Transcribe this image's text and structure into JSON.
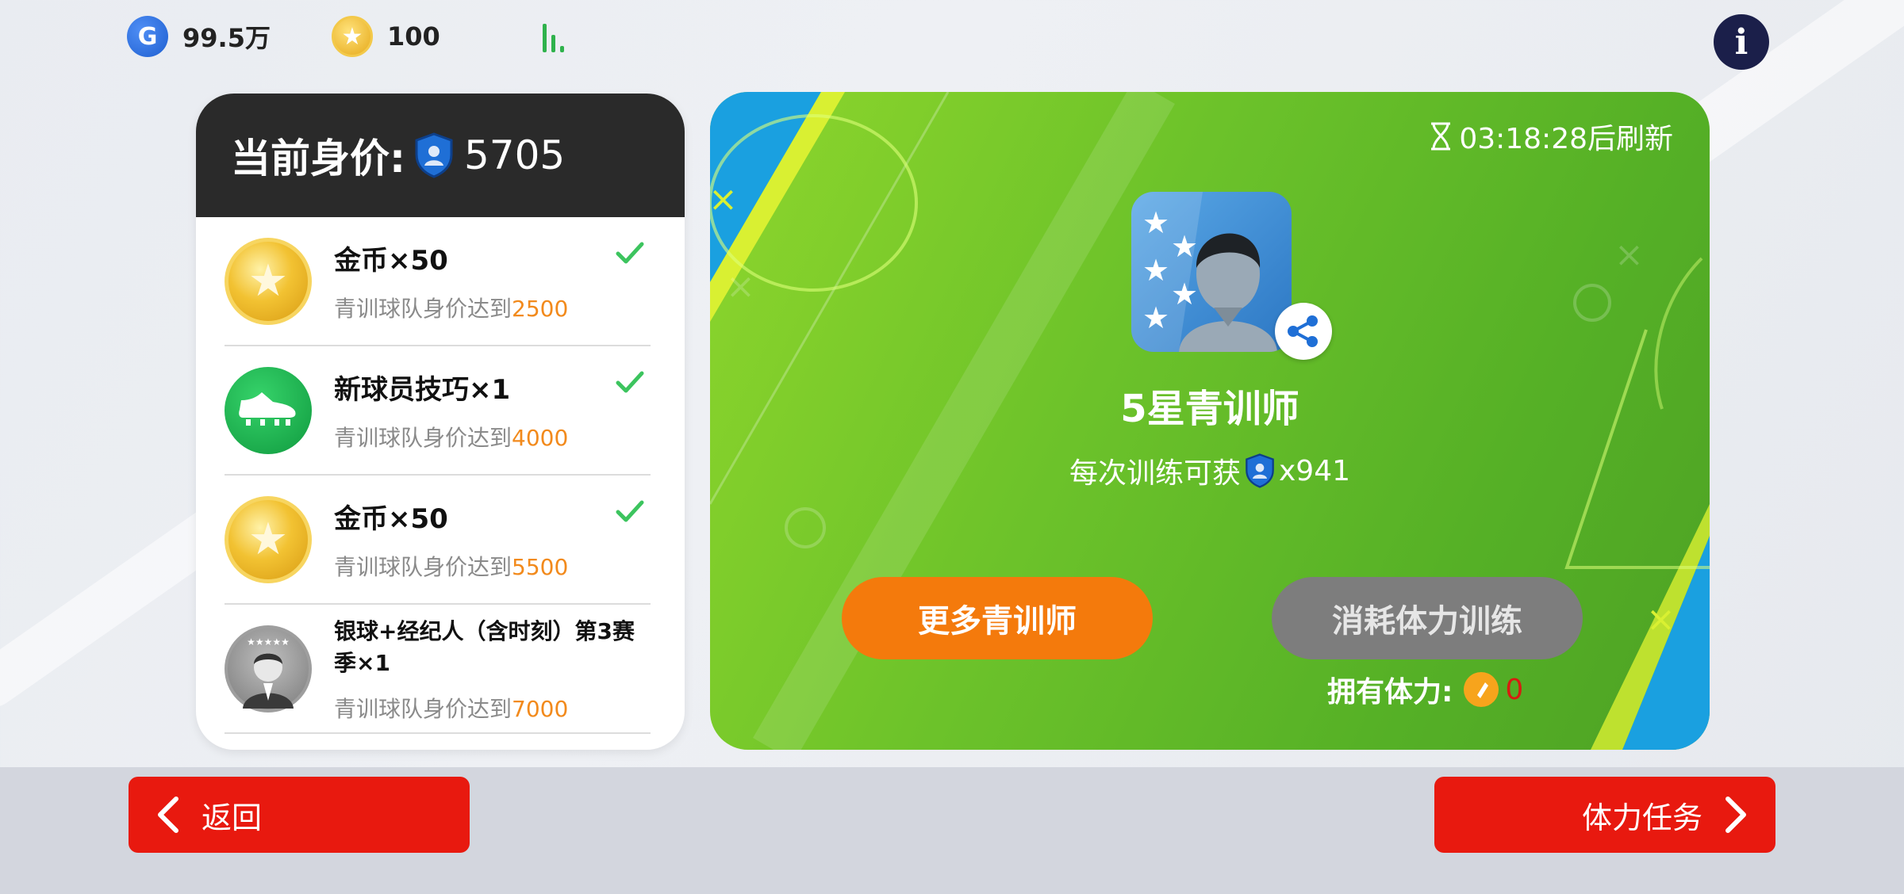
{
  "topbar": {
    "g_icon": "G",
    "g_currency": "99.5万",
    "coins": "100",
    "info_icon": "i"
  },
  "left_panel": {
    "title": "当前身价:",
    "value": "5705",
    "rewards": [
      {
        "name": "金币×50",
        "cond_prefix": "青训球队身价达到",
        "cond_value": "2500",
        "icon": "gold-coin-icon",
        "completed": true
      },
      {
        "name": "新球员技巧×1",
        "cond_prefix": "青训球队身价达到",
        "cond_value": "4000",
        "icon": "boot-icon",
        "completed": true
      },
      {
        "name": "金币×50",
        "cond_prefix": "青训球队身价达到",
        "cond_value": "5500",
        "icon": "gold-coin-icon",
        "completed": true
      },
      {
        "name": "银球+经纪人（含时刻）第3赛季×1",
        "cond_prefix": "青训球队身价达到",
        "cond_value": "7000",
        "icon": "agent-avatar-icon",
        "completed": false
      }
    ]
  },
  "right_panel": {
    "timer": "03:18:28后刷新",
    "coach_name": "5星青训师",
    "desc_prefix": "每次训练可获",
    "desc_value": "x941",
    "btn_more": "更多青训师",
    "btn_train": "消耗体力训练",
    "stamina_label": "拥有体力:",
    "stamina_value": "0"
  },
  "nav": {
    "back": "返回",
    "task": "体力任务"
  },
  "colors": {
    "accent_orange": "#f47a0c",
    "nav_red": "#e8190f",
    "field_green": "#6cc22a",
    "check_green": "#3cc45e"
  }
}
